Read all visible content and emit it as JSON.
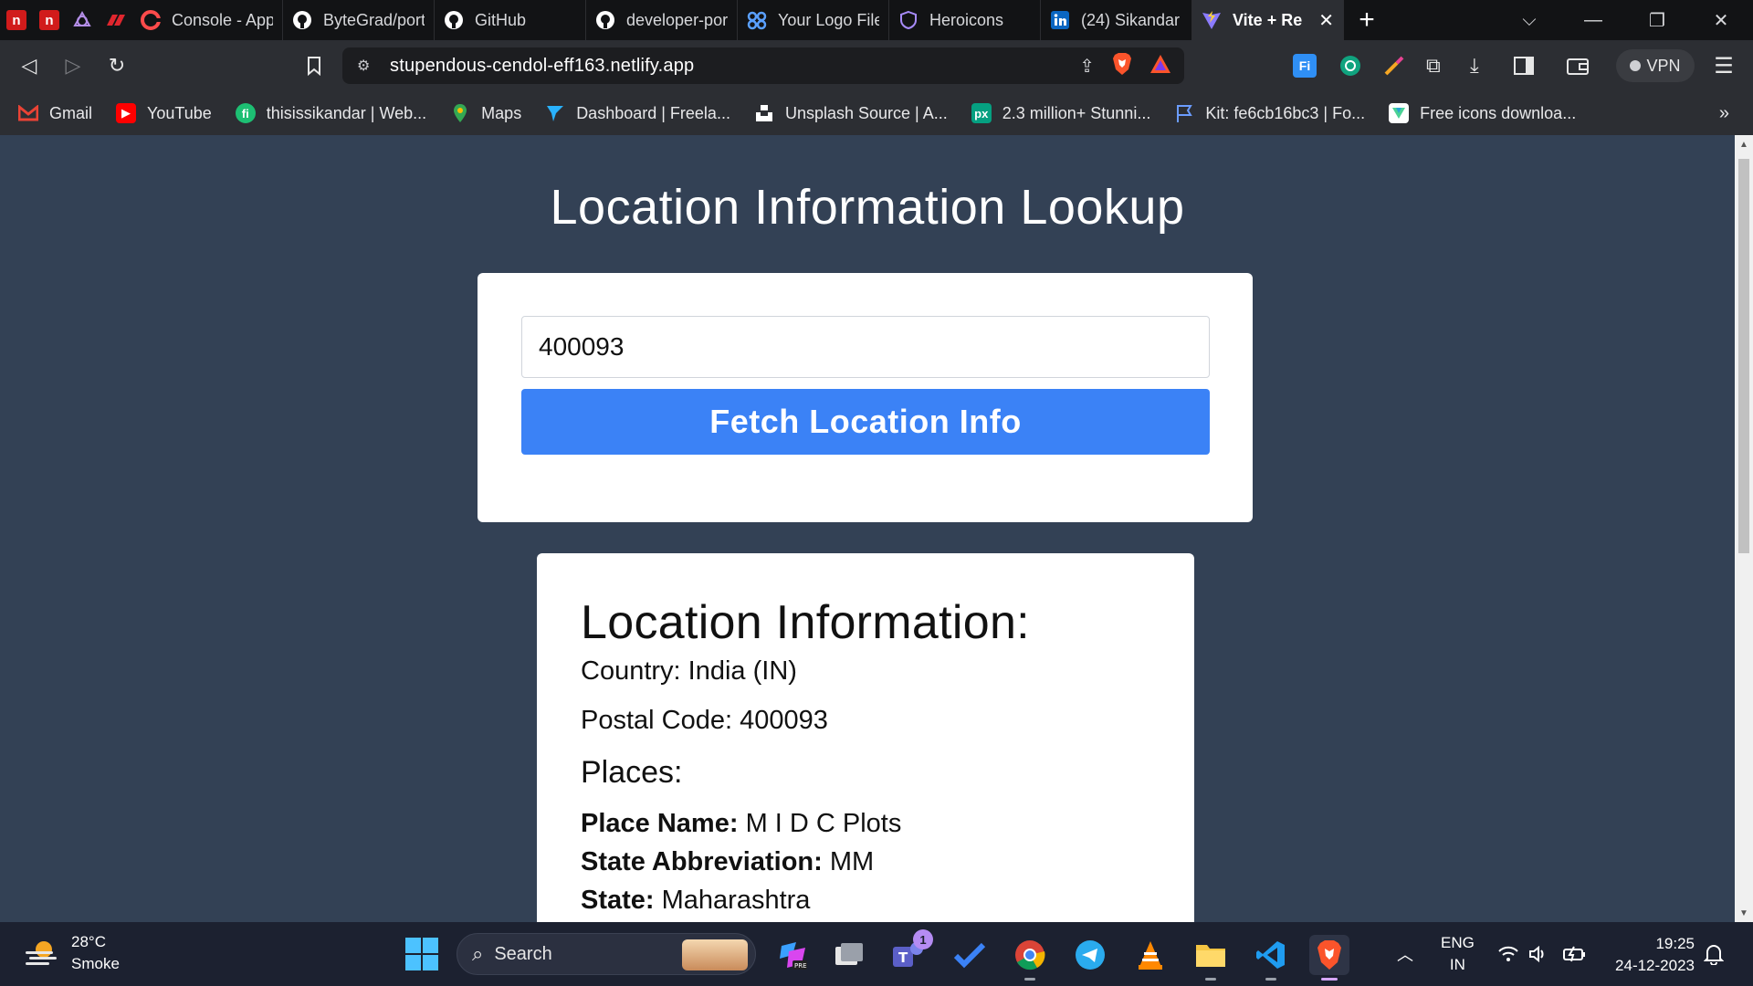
{
  "tabs": [
    {
      "label": "Console - App",
      "icon": "red-c-icon"
    },
    {
      "label": "ByteGrad/port",
      "icon": "github-icon"
    },
    {
      "label": "GitHub",
      "icon": "github-icon"
    },
    {
      "label": "developer-por",
      "icon": "github-icon"
    },
    {
      "label": "Your Logo File",
      "icon": "logo-link-icon"
    },
    {
      "label": "Heroicons",
      "icon": "shield-icon"
    },
    {
      "label": "(24) Sikandar",
      "icon": "linkedin-icon"
    },
    {
      "label": "Vite + Re",
      "icon": "vite-icon"
    }
  ],
  "browser": {
    "url": "stupendous-cendol-eff163.netlify.app",
    "vpn_label": "VPN",
    "more_bookmarks": "»"
  },
  "bookmarks": [
    {
      "label": "Gmail"
    },
    {
      "label": "YouTube"
    },
    {
      "label": "thisissikandar | Web..."
    },
    {
      "label": "Maps"
    },
    {
      "label": "Dashboard | Freela..."
    },
    {
      "label": "Unsplash Source | A..."
    },
    {
      "label": "2.3 million+ Stunni..."
    },
    {
      "label": "Kit: fe6cb16bc3 | Fo..."
    },
    {
      "label": "Free icons downloa..."
    }
  ],
  "page": {
    "title": "Location Information Lookup",
    "zip_value": "400093",
    "button_label": "Fetch Location Info",
    "info_title": "Location Information:",
    "country": "Country: India (IN)",
    "postal": "Postal Code: 400093",
    "places_title": "Places:",
    "place": {
      "name_label": "Place Name:",
      "name_value": "M I D C Plots",
      "abbr_label": "State Abbreviation:",
      "abbr_value": "MM",
      "state_label": "State:",
      "state_value": "Maharashtra"
    }
  },
  "taskbar": {
    "temperature": "28°C",
    "weather": "Smoke",
    "search_label": "Search",
    "lang_top": "ENG",
    "lang_bottom": "IN",
    "time": "19:25",
    "date": "24-12-2023",
    "teams_badge": "1"
  },
  "colors": {
    "page_bg": "#334155",
    "button_bg": "#3b82f6",
    "card_bg": "#ffffff"
  }
}
